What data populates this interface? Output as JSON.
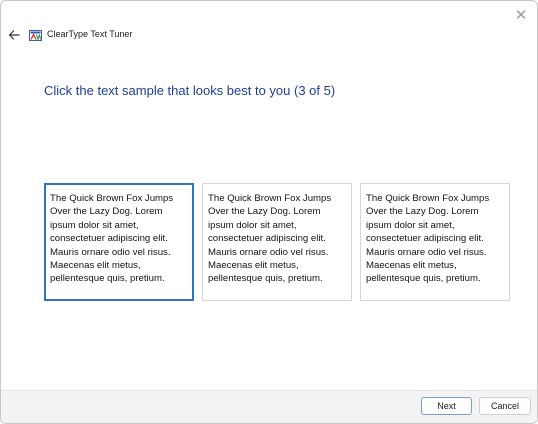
{
  "window": {
    "title": "ClearType Text Tuner",
    "close_glyph": "✕"
  },
  "heading": "Click the text sample that looks best to you (3 of 5)",
  "samples": [
    {
      "text": "The Quick Brown Fox Jumps Over the Lazy Dog. Lorem ipsum dolor sit amet, consectetuer adipiscing elit. Mauris ornare odio vel risus. Maecenas elit metus, pellentesque quis, pretium.",
      "selected": true
    },
    {
      "text": "The Quick Brown Fox Jumps Over the Lazy Dog. Lorem ipsum dolor sit amet, consectetuer adipiscing elit. Mauris ornare odio vel risus. Maecenas elit metus, pellentesque quis, pretium.",
      "selected": false
    },
    {
      "text": "The Quick Brown Fox Jumps Over the Lazy Dog. Lorem ipsum dolor sit amet, consectetuer adipiscing elit. Mauris ornare odio vel risus. Maecenas elit metus, pellentesque quis, pretium.",
      "selected": false
    }
  ],
  "buttons": {
    "next": "Next",
    "cancel": "Cancel"
  },
  "icons": {
    "back": "back-arrow-icon",
    "app": "cleartype-icon",
    "close": "close-icon"
  },
  "colors": {
    "heading": "#1d3f95",
    "selected_border": "#2f73c5"
  }
}
